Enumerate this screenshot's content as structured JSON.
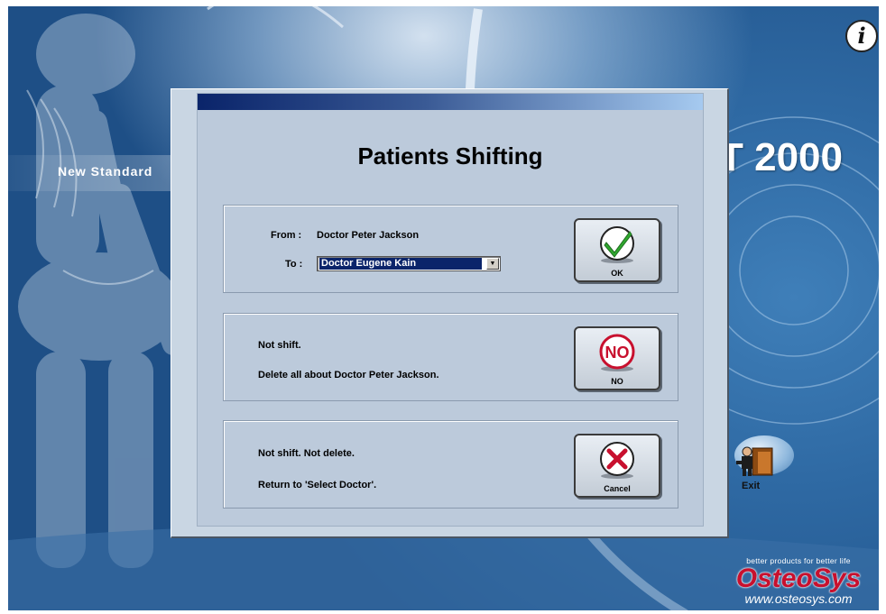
{
  "app": {
    "tagline": "New Standard",
    "product_title": "T 2000",
    "info_label": "i",
    "exit_label": "Exit",
    "brand": {
      "tagline": "better products for better life",
      "name_prefix": "Osteo",
      "name_suffix": "Sys",
      "url": "www.osteosys.com"
    }
  },
  "dialog": {
    "title": "Patients Shifting",
    "shift_group": {
      "from_label": "From :",
      "from_value": "Doctor Peter Jackson",
      "to_label": "To :",
      "to_selected": "Doctor Eugene Kain",
      "ok_label": "OK"
    },
    "no_group": {
      "line1": "Not shift.",
      "line2": "Delete all about Doctor Peter Jackson.",
      "button_icon_text": "NO",
      "button_label": "NO"
    },
    "cancel_group": {
      "line1": "Not shift. Not delete.",
      "line2": "Return to 'Select Doctor'.",
      "button_label": "Cancel"
    }
  },
  "icons": {
    "ok": "checkmark-icon",
    "no": "no-sign-icon",
    "cancel": "x-icon",
    "exit": "exit-door-icon",
    "info": "info-icon"
  },
  "colors": {
    "dialog_bg": "#bccadb",
    "title_bar_start": "#0a246a",
    "title_bar_end": "#a6caf0",
    "ok_green": "#2fa82f",
    "no_red": "#c8102e",
    "brand_red": "#c8102e"
  }
}
